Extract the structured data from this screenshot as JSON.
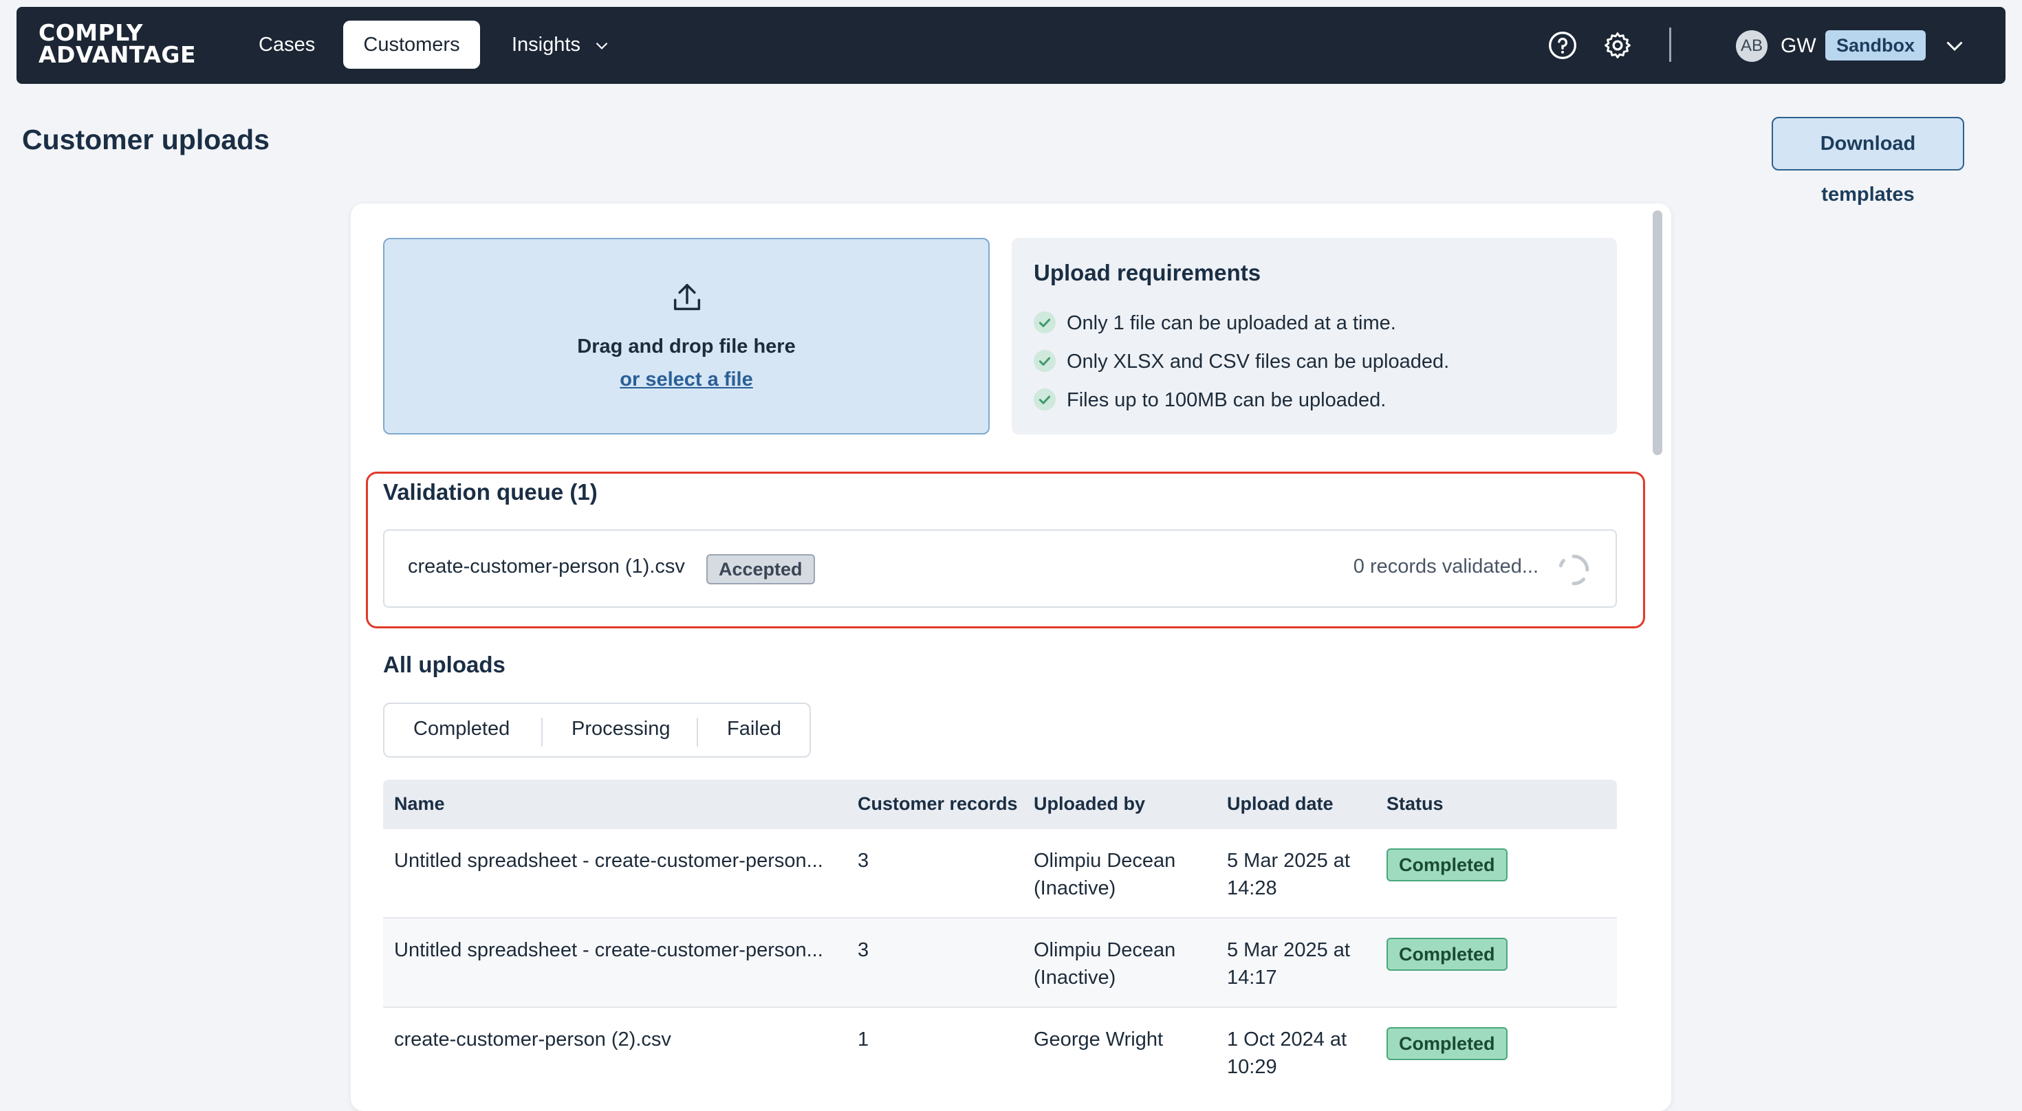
{
  "nav": {
    "logo_line1": "COMPLY",
    "logo_line2": "ADVANTAGE",
    "links": [
      "Cases",
      "Customers",
      "Insights"
    ],
    "active_link": "Customers",
    "user_initials_avatar": "AB",
    "user_initials": "GW",
    "environment": "Sandbox",
    "icons": [
      "help-icon",
      "gear-icon",
      "chevron-down-icon"
    ]
  },
  "page": {
    "title": "Customer uploads",
    "download_templates": "Download templates"
  },
  "dropzone": {
    "text": "Drag and drop file here",
    "link": "or select a file"
  },
  "requirements": {
    "title": "Upload requirements",
    "items": [
      "Only 1 file can be uploaded at a time.",
      "Only XLSX and CSV files can be uploaded.",
      "Files up to 100MB can be uploaded."
    ]
  },
  "validation_queue": {
    "title": "Validation queue (1)",
    "file": "create-customer-person (1).csv",
    "badge": "Accepted",
    "status": "0 records validated..."
  },
  "uploads": {
    "title": "All uploads",
    "tabs": [
      "Completed",
      "Processing",
      "Failed"
    ],
    "columns": [
      "Name",
      "Customer records",
      "Uploaded by",
      "Upload date",
      "Status"
    ],
    "rows": [
      {
        "name": "Untitled spreadsheet - create-customer-person...",
        "records": "3",
        "by": "Olimpiu Decean (Inactive)",
        "date": "5 Mar 2025 at 14:28",
        "status": "Completed"
      },
      {
        "name": "Untitled spreadsheet - create-customer-person...",
        "records": "3",
        "by": "Olimpiu Decean (Inactive)",
        "date": "5 Mar 2025 at 14:17",
        "status": "Completed"
      },
      {
        "name": "create-customer-person (2).csv",
        "records": "1",
        "by": "George Wright",
        "date": "1 Oct 2024 at 10:29",
        "status": "Completed"
      }
    ]
  },
  "colors": {
    "nav_bg": "#1c2634",
    "accent": "#2a5f97",
    "highlight_border": "#e03a2a",
    "completed_badge": "#9fdcbf"
  }
}
